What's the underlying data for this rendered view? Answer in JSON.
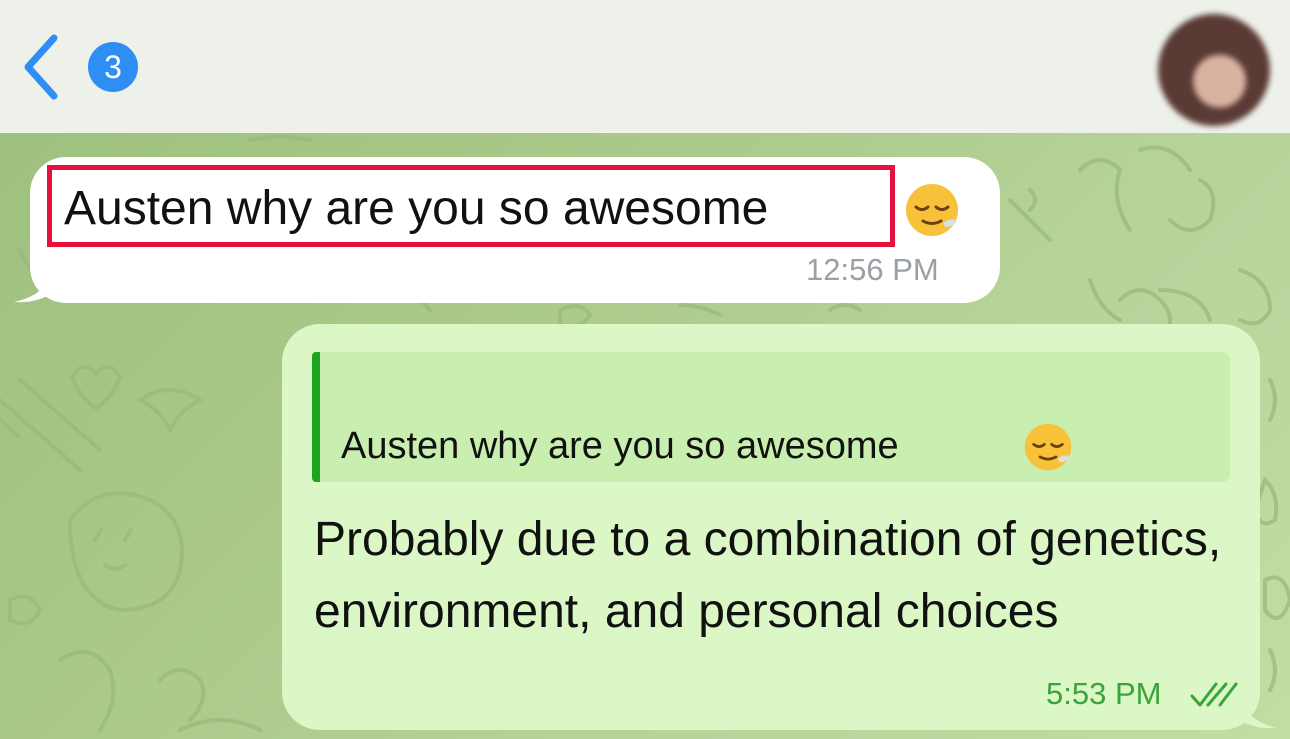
{
  "header": {
    "unread_count": "3",
    "back_icon": "chevron-left-icon",
    "avatar_icon": "contact-avatar"
  },
  "messages": [
    {
      "direction": "incoming",
      "text": "Austen why are you so awesome",
      "emoji": "relieved-face",
      "time": "12:56 PM",
      "highlighted": true
    },
    {
      "direction": "outgoing",
      "reply_to": {
        "text": "Austen why are you so awesome",
        "emoji": "relieved-face"
      },
      "text": "Probably due to a combination of genetics, environment, and personal choices",
      "time": "5:53 PM",
      "status_icon": "double-check-icon"
    }
  ],
  "colors": {
    "accent_blue": "#2f8ef4",
    "highlight_red": "#e6103c",
    "outgoing_bubble": "#dbf7c6",
    "incoming_bubble": "#ffffff",
    "reply_bar": "#1ea31e",
    "outgoing_time": "#3aa43a"
  }
}
